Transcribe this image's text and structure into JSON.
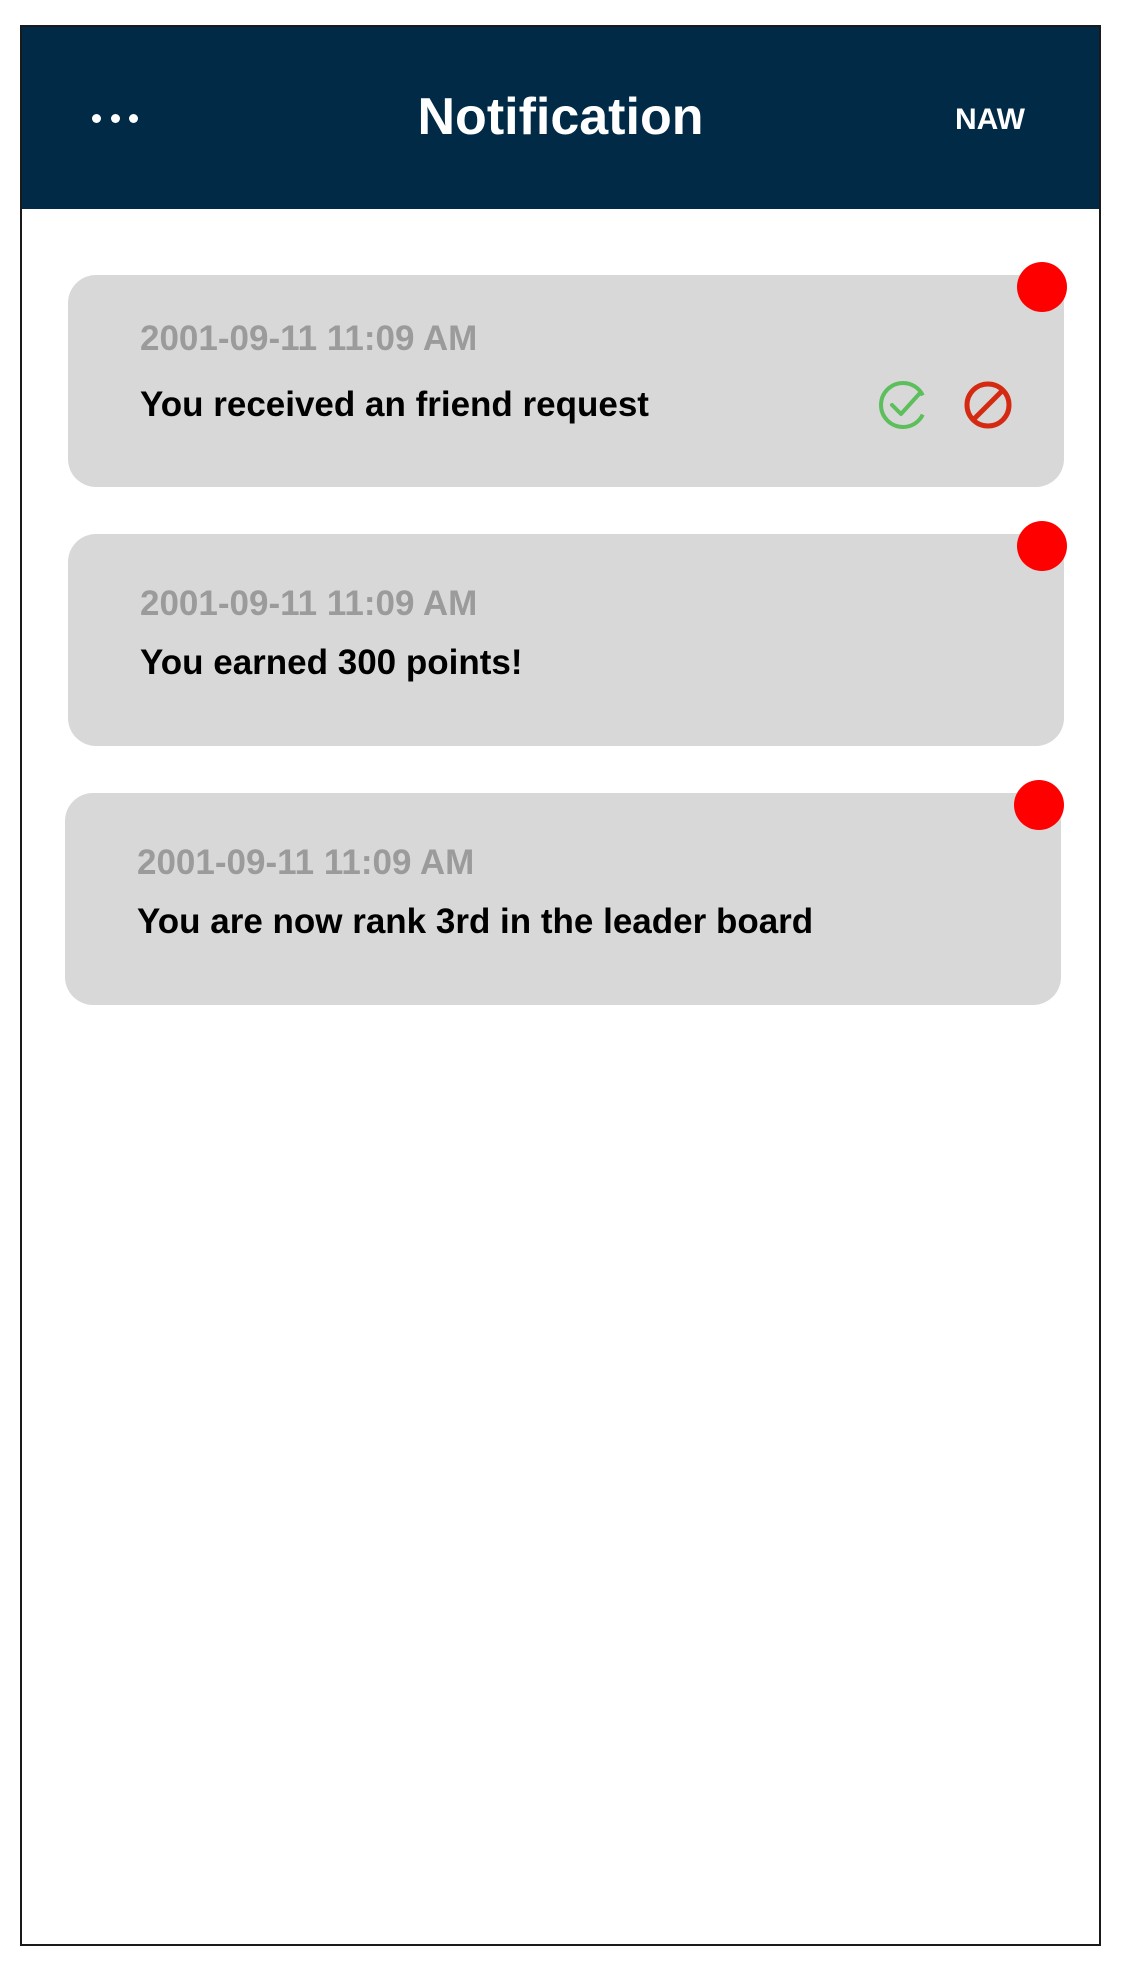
{
  "header": {
    "title": "Notification",
    "user_label": "NAW",
    "menu_icon": "more-dots-icon",
    "background": "#002a46"
  },
  "notifications": [
    {
      "timestamp": "2001-09-11 11:09 AM",
      "message": "You received an friend request",
      "unread": true,
      "actions": {
        "accept_icon": "check-circle-icon",
        "decline_icon": "block-icon"
      }
    },
    {
      "timestamp": "2001-09-11 11:09 AM",
      "message": "You earned 300 points!",
      "unread": true
    },
    {
      "timestamp": "2001-09-11 11:09 AM",
      "message": "You are now rank 3rd in the leader board",
      "unread": true
    }
  ],
  "colors": {
    "card_background": "#d8d8d8",
    "unread_dot": "#ff0000",
    "accept": "#5cbf5c",
    "decline": "#d42a12",
    "timestamp_text": "#9b9b9b"
  }
}
